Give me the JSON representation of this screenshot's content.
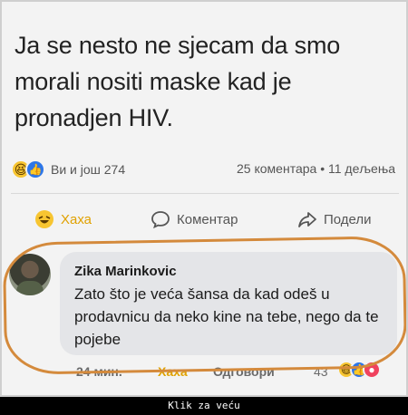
{
  "post": {
    "text": "Ja se nesto ne sjecam da smo morali nositi maske kad je pronadjen HIV."
  },
  "stats": {
    "reactions_text": "Ви и још 274",
    "right_text": "25 коментара • 11 дељења"
  },
  "actions": {
    "haha": "Хаха",
    "comment": "Коментар",
    "share": "Подели"
  },
  "comment": {
    "author": "Zika Marinkovic",
    "text": "Zato što je veća šansa da kad odeš u prodavnicu da neko kine na tebe, nego da te pojebe",
    "time": "24 мин.",
    "haha_label": "Хаха",
    "reply_label": "Одговори",
    "reaction_count": "43"
  },
  "colors": {
    "annotation_oval": "#d48a3c",
    "haha_accent": "#e0a100",
    "like_blue": "#2d76e8"
  },
  "footer": {
    "label": "Klik za veću"
  }
}
